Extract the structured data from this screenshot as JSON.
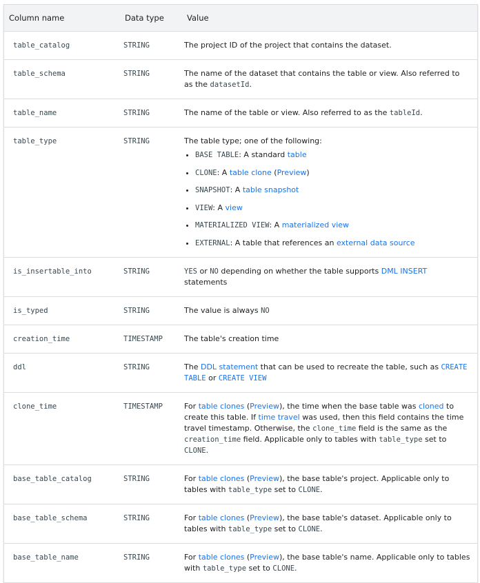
{
  "headers": {
    "col1": "Column name",
    "col2": "Data type",
    "col3": "Value"
  },
  "rows": {
    "table_catalog": {
      "name": "table_catalog",
      "type": "STRING",
      "v1": "The project ID of the project that contains the dataset."
    },
    "table_schema": {
      "name": "table_schema",
      "type": "STRING",
      "v1": "The name of the dataset that contains the table or view. Also referred to as the ",
      "c1": "datasetId",
      "v2": "."
    },
    "table_name": {
      "name": "table_name",
      "type": "STRING",
      "v1": "The name of the table or view. Also referred to as the ",
      "c1": "tableId",
      "v2": "."
    },
    "table_type": {
      "name": "table_type",
      "type": "STRING",
      "v1": "The table type; one of the following:",
      "items": [
        {
          "code": "BASE TABLE",
          "text": ": A standard ",
          "link": "table",
          "after": ""
        },
        {
          "code": "CLONE",
          "text": ": A ",
          "link": "table clone",
          "after_open": " (",
          "link2": "Preview",
          "after": ")"
        },
        {
          "code": "SNAPSHOT",
          "text": ": A ",
          "link": "table snapshot",
          "after": ""
        },
        {
          "code": "VIEW",
          "text": ": A ",
          "link": "view",
          "after": ""
        },
        {
          "code": "MATERIALIZED VIEW",
          "text": ": A ",
          "link": "materialized view",
          "after": ""
        },
        {
          "code": "EXTERNAL",
          "text": ": A table that references an ",
          "link": "external data source",
          "after": ""
        }
      ]
    },
    "is_insertable_into": {
      "name": "is_insertable_into",
      "type": "STRING",
      "c1": "YES",
      "v1": " or ",
      "c2": "NO",
      "v2": " depending on whether the table supports ",
      "link": "DML INSERT",
      "v3": " statements"
    },
    "is_typed": {
      "name": "is_typed",
      "type": "STRING",
      "v1": "The value is always ",
      "c1": "NO"
    },
    "creation_time": {
      "name": "creation_time",
      "type": "TIMESTAMP",
      "v1": "The table's creation time"
    },
    "ddl": {
      "name": "ddl",
      "type": "STRING",
      "v1": "The ",
      "link": "DDL statement",
      "v2": " that can be used to recreate the table, such as ",
      "c1": "CREATE TABLE",
      "v3": " or ",
      "c2": "CREATE VIEW"
    },
    "clone_time": {
      "name": "clone_time",
      "type": "TIMESTAMP",
      "v1": "For ",
      "link1": "table clones",
      "v2": " (",
      "link2": "Preview",
      "v3": "), the time when the base table was ",
      "link3": "cloned",
      "v4": " to create this table. If ",
      "link4": "time travel",
      "v5": " was used, then this field contains the time travel timestamp. Otherwise, the ",
      "c1": "clone_time",
      "v6": " field is the same as the ",
      "c2": "creation_time",
      "v7": " field. Applicable only to tables with ",
      "c3": "table_type",
      "v8": " set to ",
      "c4": "CLONE",
      "v9": "."
    },
    "base_table_catalog": {
      "name": "base_table_catalog",
      "type": "STRING",
      "v1": "For ",
      "link1": "table clones",
      "v2": " (",
      "link2": "Preview",
      "v3": "), the base table's project. Applicable only to tables with ",
      "c1": "table_type",
      "v4": " set to ",
      "c2": "CLONE",
      "v5": "."
    },
    "base_table_schema": {
      "name": "base_table_schema",
      "type": "STRING",
      "v1": "For ",
      "link1": "table clones",
      "v2": " (",
      "link2": "Preview",
      "v3": "), the base table's dataset. Applicable only to tables with ",
      "c1": "table_type",
      "v4": " set to ",
      "c2": "CLONE",
      "v5": "."
    },
    "base_table_name": {
      "name": "base_table_name",
      "type": "STRING",
      "v1": "For ",
      "link1": "table clones",
      "v2": " (",
      "link2": "Preview",
      "v3": "), the base table's name. Applicable only to tables with ",
      "c1": "table_type",
      "v4": " set to ",
      "c2": "CLONE",
      "v5": "."
    }
  }
}
